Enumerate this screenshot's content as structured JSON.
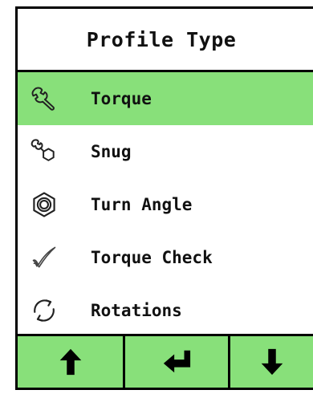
{
  "colors": {
    "accent": "#88e07a"
  },
  "header": {
    "title": "Profile Type"
  },
  "menu": {
    "selected_index": 0,
    "items": [
      {
        "label": "Torque",
        "icon": "wrench-icon"
      },
      {
        "label": "Snug",
        "icon": "wrench-nut-icon"
      },
      {
        "label": "Turn Angle",
        "icon": "hex-nut-icon"
      },
      {
        "label": "Torque Check",
        "icon": "checkmark-icon"
      },
      {
        "label": "Rotations",
        "icon": "rotate-icon"
      }
    ]
  },
  "buttons": [
    {
      "name": "up-button",
      "icon": "arrow-up-icon"
    },
    {
      "name": "enter-button",
      "icon": "enter-icon"
    },
    {
      "name": "down-button",
      "icon": "arrow-down-icon"
    }
  ]
}
